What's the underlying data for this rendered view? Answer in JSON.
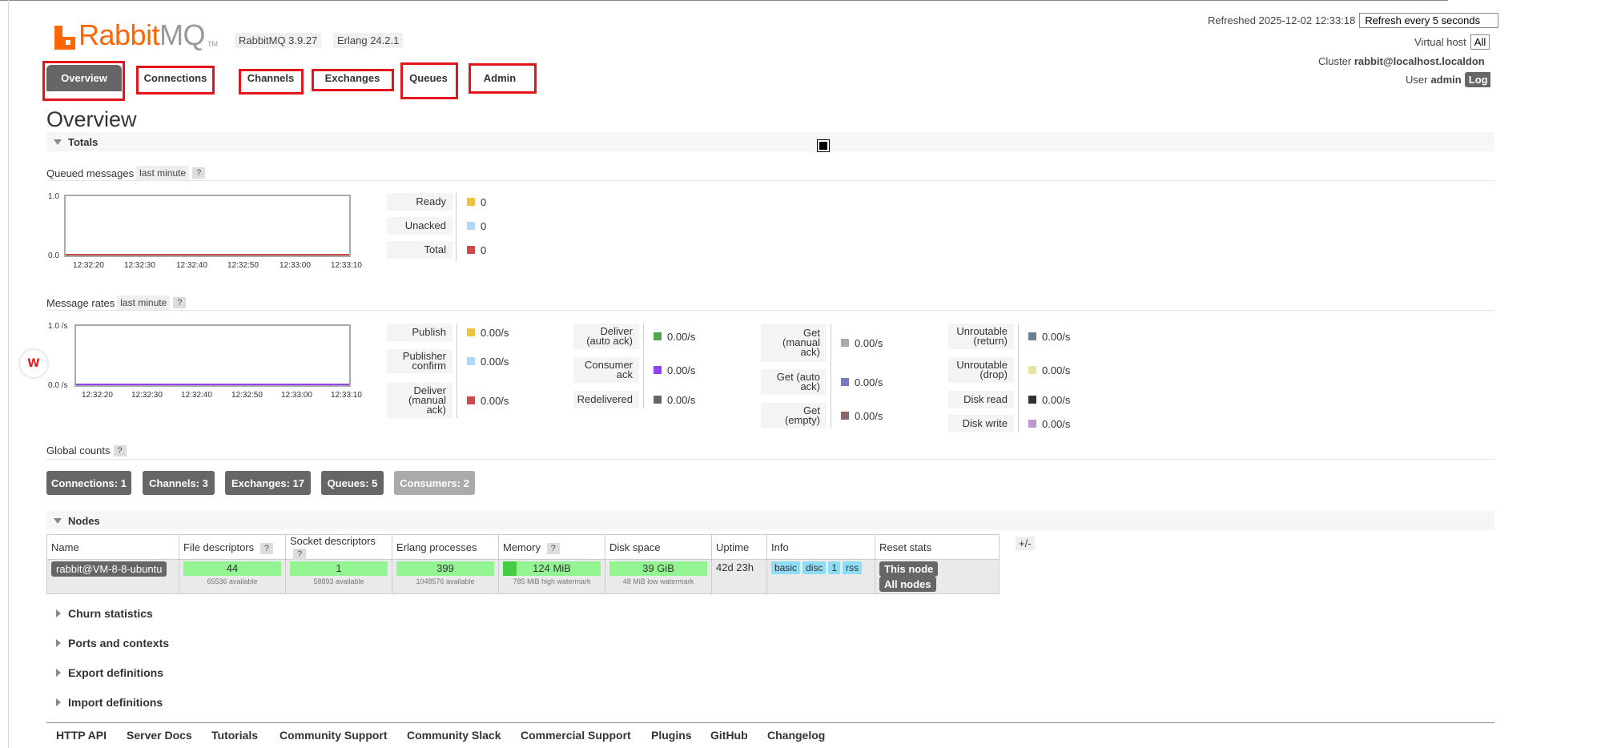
{
  "app": {
    "logo_prefix": "Rabbit",
    "logo_suffix": "MQ",
    "logo_tm": "TM",
    "version": "RabbitMQ 3.9.27",
    "erlang": "Erlang 24.2.1"
  },
  "header": {
    "refreshed": "Refreshed 2025-12-02 12:33:18",
    "refresh_option": "Refresh every 5 seconds",
    "vhost_label": "Virtual host",
    "vhost_value": "All",
    "cluster_label": "Cluster",
    "cluster_value": "rabbit@localhost.localdon",
    "user_label": "User",
    "user_value": "admin",
    "logout_label": "Log"
  },
  "tabs": [
    "Overview",
    "Connections",
    "Channels",
    "Exchanges",
    "Queues",
    "Admin"
  ],
  "page_title": "Overview",
  "totals": {
    "heading": "Totals",
    "queued": {
      "label": "Queued messages",
      "range": "last minute",
      "help": "?",
      "y_max": "1.0",
      "y_min": "0.0",
      "x_ticks": [
        "12:32:20",
        "12:32:30",
        "12:32:40",
        "12:32:50",
        "12:33:00",
        "12:33:10"
      ],
      "legend": [
        {
          "label": "Ready",
          "value": "0",
          "color": "#edc240"
        },
        {
          "label": "Unacked",
          "value": "0",
          "color": "#afd8f8"
        },
        {
          "label": "Total",
          "value": "0",
          "color": "#cb4b4b"
        }
      ]
    },
    "rates": {
      "label": "Message rates",
      "range": "last minute",
      "help": "?",
      "y_max": "1.0 /s",
      "y_min": "0.0 /s",
      "x_ticks": [
        "12:32:20",
        "12:32:30",
        "12:32:40",
        "12:32:50",
        "12:33:00",
        "12:33:10"
      ],
      "col1": [
        {
          "label": "Publish",
          "value": "0.00/s",
          "color": "#edc240"
        },
        {
          "label": "Publisher confirm",
          "value": "0.00/s",
          "color": "#afd8f8"
        },
        {
          "label": "Deliver (manual ack)",
          "value": "0.00/s",
          "color": "#cb4b4b"
        }
      ],
      "col2": [
        {
          "label": "Deliver (auto ack)",
          "value": "0.00/s",
          "color": "#4da74d"
        },
        {
          "label": "Consumer ack",
          "value": "0.00/s",
          "color": "#9440ed"
        },
        {
          "label": "Redelivered",
          "value": "0.00/s",
          "color": "#666666"
        }
      ],
      "col3": [
        {
          "label": "Get (manual ack)",
          "value": "0.00/s",
          "color": "#aaaaaa"
        },
        {
          "label": "Get (auto ack)",
          "value": "0.00/s",
          "color": "#7c79c3"
        },
        {
          "label": "Get (empty)",
          "value": "0.00/s",
          "color": "#8d6363"
        }
      ],
      "col4": [
        {
          "label": "Unroutable (return)",
          "value": "0.00/s",
          "color": "#6c8090"
        },
        {
          "label": "Unroutable (drop)",
          "value": "0.00/s",
          "color": "#e6e6a0"
        },
        {
          "label": "Disk read",
          "value": "0.00/s",
          "color": "#333333"
        },
        {
          "label": "Disk write",
          "value": "0.00/s",
          "color": "#c098d0"
        }
      ]
    },
    "global": {
      "label": "Global counts",
      "help": "?",
      "buttons": [
        "Connections: 1",
        "Channels: 3",
        "Exchanges: 17",
        "Queues: 5",
        "Consumers: 2"
      ]
    }
  },
  "nodes": {
    "heading": "Nodes",
    "plusminus": "+/-",
    "columns": [
      "Name",
      "File descriptors",
      "Socket descriptors",
      "Erlang processes",
      "Memory",
      "Disk space",
      "Uptime",
      "Info",
      "Reset stats"
    ],
    "help": "?",
    "row": {
      "name": "rabbit@VM-8-8-ubuntu",
      "fd": "44",
      "fd_sub": "65536 available",
      "sd": "1",
      "sd_sub": "58893 available",
      "ep": "399",
      "ep_sub": "1048576 available",
      "mem": "124 MiB",
      "mem_sub": "785 MiB high watermark",
      "disk": "39 GiB",
      "disk_sub": "48 MiB low watermark",
      "uptime": "42d 23h",
      "info": [
        "basic",
        "disc",
        "1",
        "rss"
      ],
      "reset_this": "This node",
      "reset_all": "All nodes"
    }
  },
  "collapsed_sections": [
    "Churn statistics",
    "Ports and contexts",
    "Export definitions",
    "Import definitions"
  ],
  "footer": [
    "HTTP API",
    "Server Docs",
    "Tutorials",
    "Community Support",
    "Community Slack",
    "Commercial Support",
    "Plugins",
    "GitHub",
    "Changelog"
  ],
  "overlay": {
    "wps_glyph": "W"
  }
}
